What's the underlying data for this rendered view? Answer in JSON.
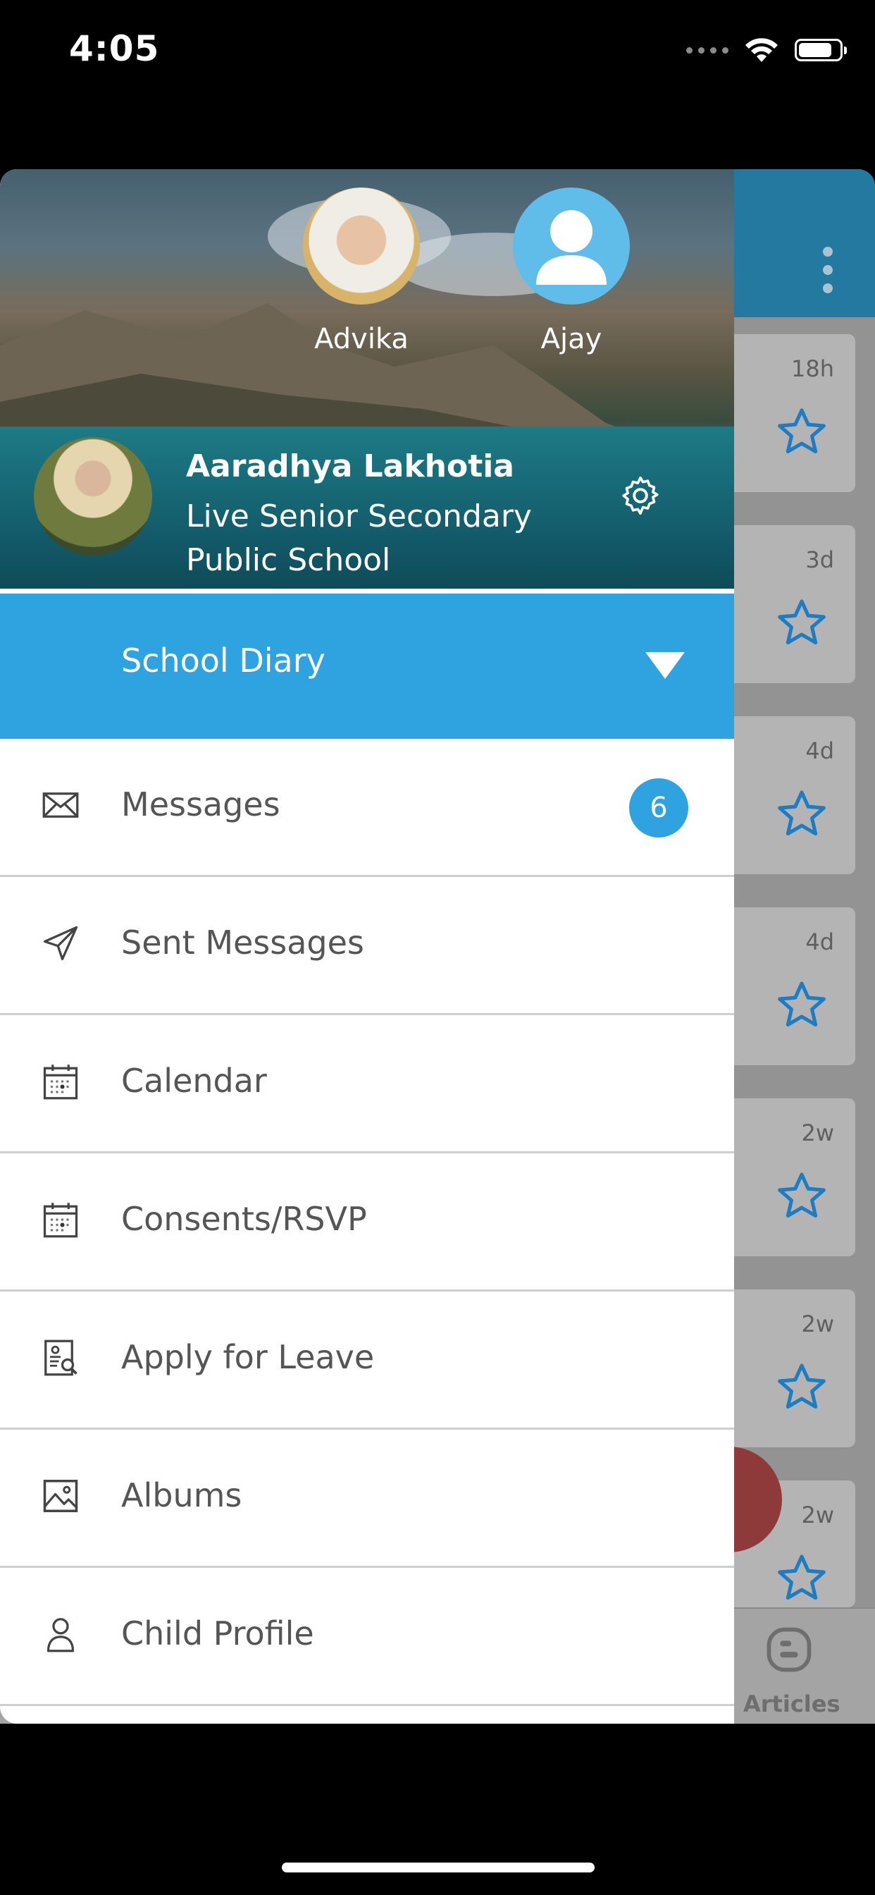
{
  "status_bar": {
    "time": "4:05",
    "battery_fraction": 0.82
  },
  "feed": {
    "timestamps": [
      "18h",
      "3d",
      "4d",
      "4d",
      "2w",
      "2w",
      "2w"
    ],
    "tab_label": "Articles",
    "accent_color": "#1e7cc2"
  },
  "accounts": [
    {
      "name": "Advika"
    },
    {
      "name": "Ajay"
    }
  ],
  "profile": {
    "name": "Aaradhya Lakhotia",
    "school_line1": "Live Senior Secondary",
    "school_line2": "Public School"
  },
  "section": {
    "label": "School Diary",
    "color": "#2fa3df"
  },
  "menu": [
    {
      "label": "Messages",
      "icon": "envelope-icon",
      "badge": "6"
    },
    {
      "label": "Sent Messages",
      "icon": "paper-plane-icon"
    },
    {
      "label": "Calendar",
      "icon": "calendar-icon"
    },
    {
      "label": "Consents/RSVP",
      "icon": "calendar-icon"
    },
    {
      "label": "Apply for Leave",
      "icon": "leave-document-icon"
    },
    {
      "label": "Albums",
      "icon": "image-icon"
    },
    {
      "label": "Child Profile",
      "icon": "person-icon"
    }
  ]
}
